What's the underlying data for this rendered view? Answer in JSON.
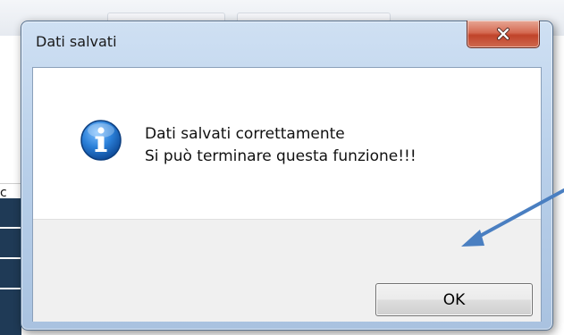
{
  "window": {
    "title": "Dati salvati",
    "close_icon": "close-icon"
  },
  "message": {
    "icon": "information-icon",
    "line1": "Dati salvati correttamente",
    "line2": "Si può terminare questa funzione!!!"
  },
  "buttons": {
    "ok_label": "OK"
  },
  "background": {
    "left_letter": "c"
  },
  "annotation": {
    "type": "arrow",
    "color": "#4a7fc1",
    "points_to": "ok-button"
  },
  "colors": {
    "dialog_frame": "#b9d0ea",
    "close_button": "#c0432a",
    "info_icon": "#1f6fc9",
    "footer": "#f0f0f0"
  }
}
